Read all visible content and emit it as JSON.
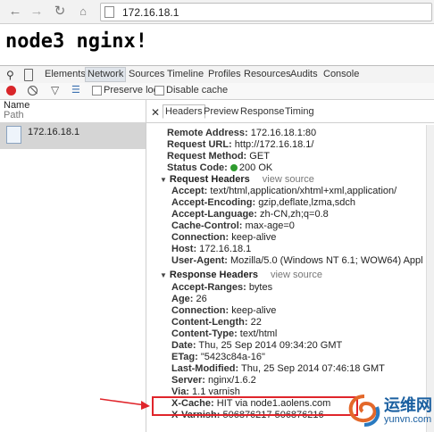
{
  "browser": {
    "url": "172.16.18.1",
    "back_icon": "back-arrow-icon",
    "forward_icon": "forward-arrow-icon",
    "reload_icon": "reload-icon",
    "home_icon": "home-icon"
  },
  "page": {
    "heading": "node3 nginx!"
  },
  "devtools": {
    "tabs": [
      "Elements",
      "Network",
      "Sources",
      "Timeline",
      "Profiles",
      "Resources",
      "Audits",
      "Console"
    ],
    "active_tab": "Network",
    "toolbar": {
      "preserve_log": "Preserve log",
      "disable_cache": "Disable cache"
    },
    "list": {
      "name_header": "Name",
      "path_header": "Path",
      "request": "172.16.18.1"
    },
    "detail_tabs": [
      "Headers",
      "Preview",
      "Response",
      "Timing"
    ],
    "active_detail_tab": "Headers",
    "general": [
      {
        "k": "Remote Address:",
        "v": "172.16.18.1:80"
      },
      {
        "k": "Request URL:",
        "v": "http://172.16.18.1/"
      },
      {
        "k": "Request Method:",
        "v": "GET"
      },
      {
        "k": "Status Code:",
        "v": "200 OK"
      }
    ],
    "request_headers_title": "Request Headers",
    "response_headers_title": "Response Headers",
    "view_source": "view source",
    "request_headers": [
      {
        "k": "Accept:",
        "v": "text/html,application/xhtml+xml,application/"
      },
      {
        "k": "Accept-Encoding:",
        "v": "gzip,deflate,lzma,sdch"
      },
      {
        "k": "Accept-Language:",
        "v": "zh-CN,zh;q=0.8"
      },
      {
        "k": "Cache-Control:",
        "v": "max-age=0"
      },
      {
        "k": "Connection:",
        "v": "keep-alive"
      },
      {
        "k": "Host:",
        "v": "172.16.18.1"
      },
      {
        "k": "User-Agent:",
        "v": "Mozilla/5.0 (Windows NT 6.1; WOW64) Appl"
      }
    ],
    "response_headers": [
      {
        "k": "Accept-Ranges:",
        "v": "bytes"
      },
      {
        "k": "Age:",
        "v": "26"
      },
      {
        "k": "Connection:",
        "v": "keep-alive"
      },
      {
        "k": "Content-Length:",
        "v": "22"
      },
      {
        "k": "Content-Type:",
        "v": "text/html"
      },
      {
        "k": "Date:",
        "v": "Thu, 25 Sep 2014 09:34:20 GMT"
      },
      {
        "k": "ETag:",
        "v": "\"5423c84a-16\""
      },
      {
        "k": "Last-Modified:",
        "v": "Thu, 25 Sep 2014 07:46:18 GMT"
      },
      {
        "k": "Server:",
        "v": "nginx/1.6.2"
      },
      {
        "k": "Via:",
        "v": "1.1 varnish"
      },
      {
        "k": "X-Cache:",
        "v": "HIT via node1.aolens.com"
      },
      {
        "k": "X-Varnish:",
        "v": "506876217 506876216"
      }
    ]
  },
  "watermark": {
    "cn": "运维网",
    "url": "yunvn.com"
  },
  "colors": {
    "highlight": "#e0252b",
    "record": "#d9262a",
    "status_ok": "#2e9b2e"
  }
}
